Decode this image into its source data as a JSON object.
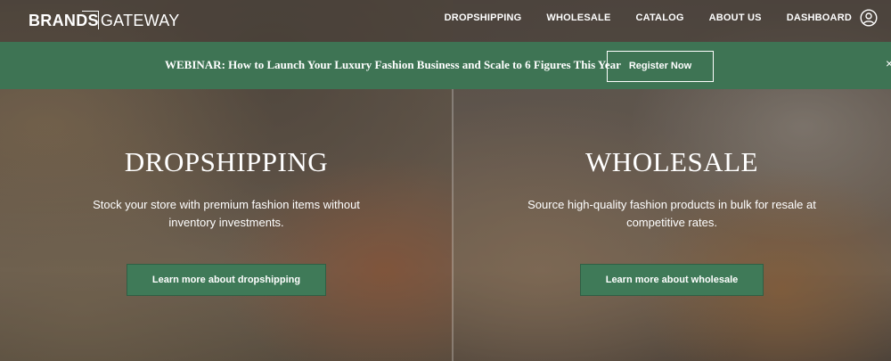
{
  "header": {
    "logo_brands": "BRANDS",
    "logo_gateway": "GATEWAY",
    "nav": [
      {
        "label": "DROPSHIPPING"
      },
      {
        "label": "WHOLESALE"
      },
      {
        "label": "CATALOG"
      },
      {
        "label": "ABOUT US"
      },
      {
        "label": "DASHBOARD"
      }
    ],
    "account_icon": "user-circle-icon"
  },
  "banner": {
    "text": "WEBINAR: How to Launch Your Luxury Fashion Business and Scale to 6 Figures This Year",
    "button_label": "Register Now",
    "close_glyph": "×",
    "color": "#3e7454"
  },
  "panels": {
    "dropshipping": {
      "title": "DROPSHIPPING",
      "description": "Stock your store with premium fashion items without inventory investments.",
      "button_label": "Learn more about dropshipping"
    },
    "wholesale": {
      "title": "WHOLESALE",
      "description": "Source high-quality fashion products in bulk for resale at competitive rates.",
      "button_label": "Learn more about wholesale"
    }
  },
  "colors": {
    "accent_green": "#3f7a58",
    "text": "#ffffff"
  }
}
